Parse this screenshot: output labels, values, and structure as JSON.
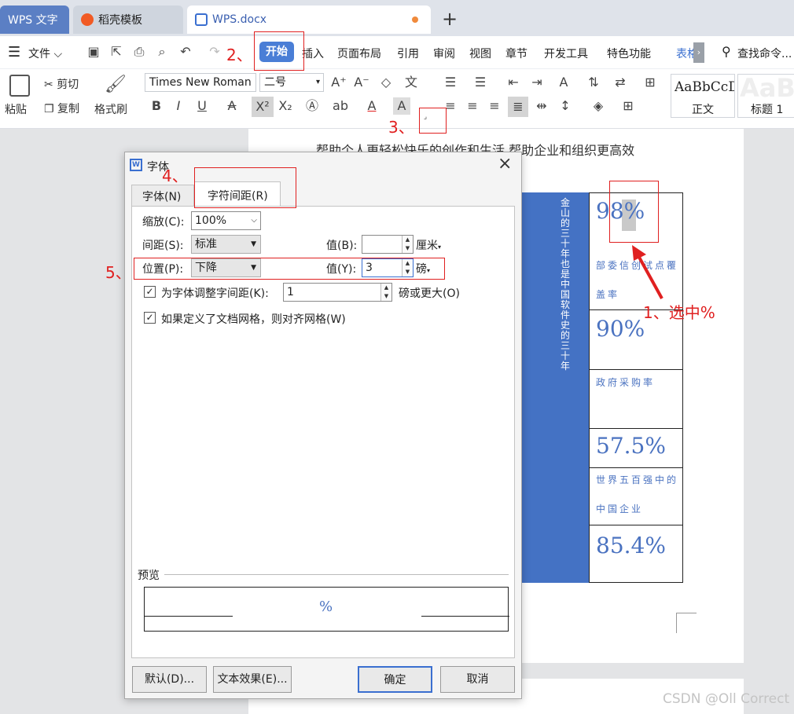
{
  "tabs": [
    {
      "label": "WPS 文字"
    },
    {
      "label": "稻壳模板"
    },
    {
      "label": "WPS.docx"
    }
  ],
  "menu": {
    "file": "文件",
    "items": [
      "开始",
      "插入",
      "页面布局",
      "引用",
      "审阅",
      "视图",
      "章节",
      "开发工具",
      "特色功能"
    ],
    "table_tab": "表格",
    "search": "查找命令..."
  },
  "ribbon": {
    "paste": "粘贴",
    "cut": "剪切",
    "copy": "复制",
    "format_painter": "格式刷",
    "font_name": "Times New Roman",
    "font_size": "二号",
    "style1_preview": "AaBbCcDd",
    "style1_name": "正文",
    "style2_preview": "AaBb",
    "style2_name": "标题 1"
  },
  "document": {
    "slogan": "帮助个人更轻松快乐的创作和生活,帮助企业和组织更高效",
    "vertical_text": "金山的三十年也是中国软件史的三十年",
    "stats": [
      {
        "value": "98%",
        "label": "部委信创试点覆盖率"
      },
      {
        "value": "90%",
        "label": "政府采购率"
      },
      {
        "value": "57.5%",
        "label": "世界五百强中的中国企业"
      },
      {
        "value": "85.4%",
        "label": ""
      }
    ]
  },
  "dialog": {
    "title": "字体",
    "tab_font": "字体(N)",
    "tab_spacing": "字符间距(R)",
    "scale_label": "缩放(C):",
    "scale_value": "100%",
    "spacing_label": "间距(S):",
    "spacing_value": "标准",
    "spacing_amount_label": "值(B):",
    "spacing_amount_value": "",
    "spacing_unit": "厘米",
    "position_label": "位置(P):",
    "position_value": "下降",
    "position_amount_label": "值(Y):",
    "position_amount_value": "3",
    "position_unit": "磅",
    "kerning_label": "为字体调整字间距(K):",
    "kerning_value": "1",
    "kerning_suffix": "磅或更大(O)",
    "grid_label": "如果定义了文档网格，则对齐网格(W)",
    "preview_label": "预览",
    "preview_text": "%",
    "btn_default": "默认(D)...",
    "btn_effects": "文本效果(E)...",
    "btn_ok": "确定",
    "btn_cancel": "取消"
  },
  "annotations": {
    "step1": "1、选中%",
    "step2": "2、",
    "step3": "3、",
    "step4": "4、",
    "step5": "5、"
  },
  "watermark": "CSDN @Oll Correct",
  "colors": {
    "accent": "#4a7ed6",
    "annotation": "#e02020",
    "table_blue": "#4472c4"
  }
}
